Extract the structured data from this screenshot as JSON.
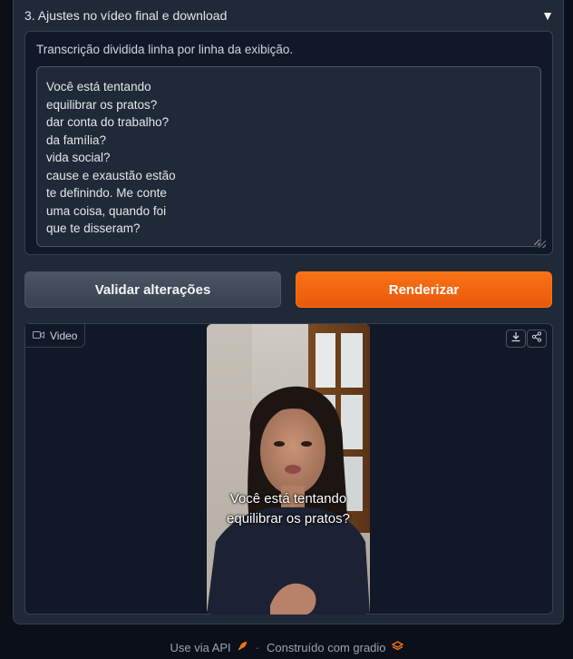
{
  "accordion": {
    "title": "3. Ajustes no vídeo final e download",
    "caret": "▼"
  },
  "transcript": {
    "label": "Transcrição dividida linha por linha da exibição.",
    "text": "Você está tentando\nequilibrar os pratos?\ndar conta do trabalho?\nda família?\nvida social?\ncause e exaustão estão\nte definindo. Me conte\numa coisa, quando foi\nque te disseram?"
  },
  "buttons": {
    "validate": "Validar alterações",
    "render": "Renderizar"
  },
  "video": {
    "label": "Video",
    "caption_line1": "Você está tentando",
    "caption_line2": "equilibrar os pratos?"
  },
  "footer": {
    "api": "Use via API",
    "separator": "·",
    "built": "Construído com gradio"
  },
  "colors": {
    "background": "#0b0f19",
    "panel": "#1f2937",
    "primary": "#f97316",
    "secondary": "#4b5563"
  },
  "icons": [
    "camera-icon",
    "download-icon",
    "share-icon",
    "rocket-icon",
    "gradio-logo-icon"
  ]
}
